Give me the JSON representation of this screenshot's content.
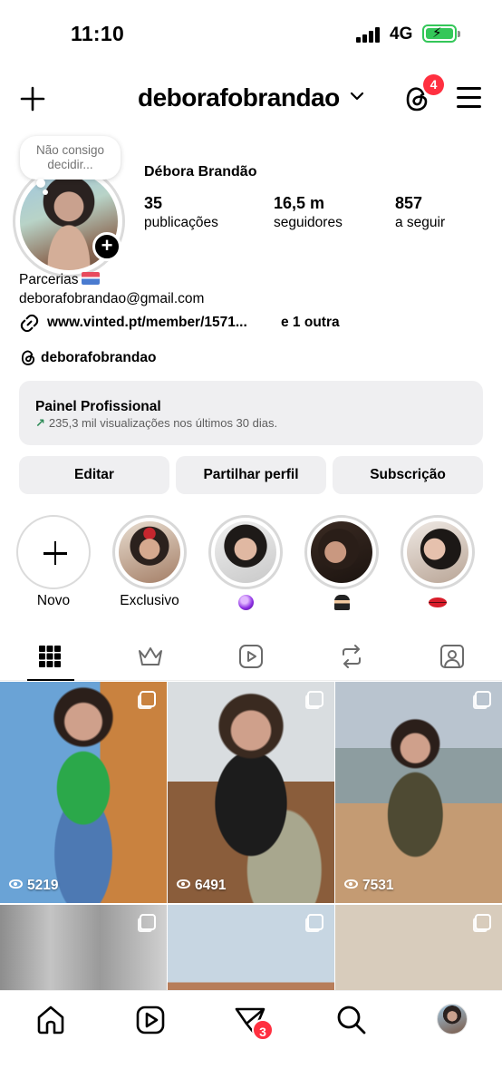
{
  "status_bar": {
    "time": "11:10",
    "network": "4G",
    "battery_level": 1.0,
    "battery_color": "#34c759"
  },
  "header": {
    "username": "deborafobrandao",
    "threads_badge": "4",
    "icons": [
      "plus-icon",
      "chevron-down-icon",
      "threads-icon",
      "menu-icon"
    ]
  },
  "profile": {
    "note": "Não consigo decidir...",
    "display_name": "Débora Brandão",
    "stats": [
      {
        "value": "35",
        "label": "publicações"
      },
      {
        "value": "16,5 m",
        "label": "seguidores"
      },
      {
        "value": "857",
        "label": "a seguir"
      }
    ],
    "bio_line1": "Parcerias",
    "email": "deborafobrandao@gmail.com",
    "link": "www.vinted.pt/member/1571...",
    "link_extra": "e 1 outra",
    "threads_handle": "deborafobrandao"
  },
  "dashboard": {
    "title": "Painel Profissional",
    "subtitle": "235,3 mil visualizações nos últimos 30 dias.",
    "trend_color": "#2e8b57"
  },
  "actions": {
    "edit": "Editar",
    "share": "Partilhar perfil",
    "subscribe": "Subscrição"
  },
  "highlights": [
    {
      "label": "Novo",
      "type": "new"
    },
    {
      "label": "Exclusivo",
      "type": "story"
    },
    {
      "label": "",
      "emoji": "crystal-ball",
      "type": "story"
    },
    {
      "label": "",
      "emoji": "ninja",
      "type": "story"
    },
    {
      "label": "",
      "emoji": "lips",
      "type": "story"
    }
  ],
  "tabs": [
    "grid-tab",
    "crown-tab",
    "reels-tab",
    "reposts-tab",
    "tagged-tab"
  ],
  "posts": [
    {
      "views": "5219"
    },
    {
      "views": "6491"
    },
    {
      "views": "7531"
    },
    {
      "views": ""
    },
    {
      "views": ""
    },
    {
      "views": ""
    }
  ],
  "bottom_nav": {
    "badge": "3",
    "items": [
      "home-icon",
      "reels-icon",
      "activity-icon",
      "search-icon",
      "profile-avatar"
    ]
  },
  "colors": {
    "badge_red": "#ff3040",
    "button_bg": "#efeff1"
  }
}
